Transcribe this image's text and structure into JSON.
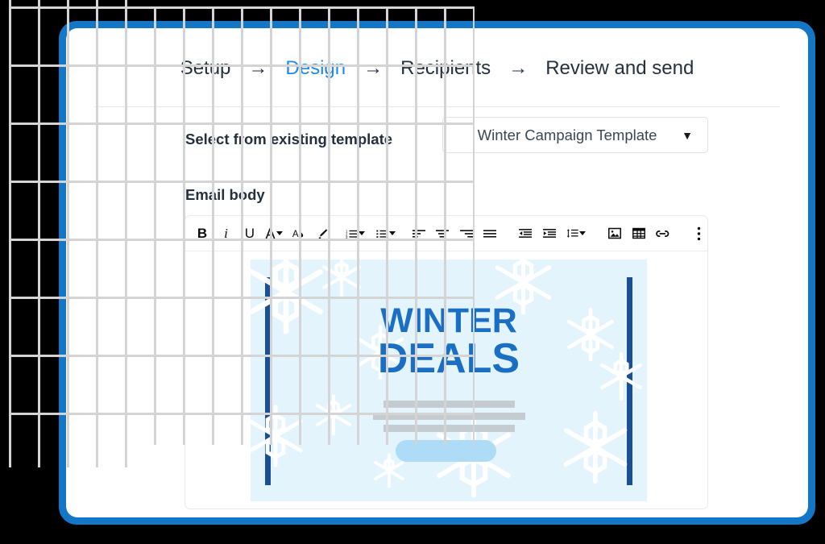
{
  "window": {
    "frame_color": "#1476c6",
    "card_background": "#ffffff"
  },
  "stepper": {
    "steps": [
      {
        "label": "Setup",
        "active": false
      },
      {
        "label": "Design",
        "active": true
      },
      {
        "label": "Recipients",
        "active": false
      },
      {
        "label": "Review and send",
        "active": false
      }
    ],
    "arrow": "→",
    "active_color": "#2089e4",
    "inactive_color": "#25303f"
  },
  "template": {
    "label": "Select from existing template",
    "selected_value": "Winter Campaign Template",
    "caret": "▼"
  },
  "email_body": {
    "label": "Email body"
  },
  "toolbar": {
    "items": [
      {
        "name": "bold",
        "glyph": "B"
      },
      {
        "name": "italic",
        "glyph": "i"
      },
      {
        "name": "underline",
        "glyph": "U"
      },
      {
        "name": "font-size",
        "glyph": "A"
      },
      {
        "name": "text-color",
        "glyph": "A"
      },
      {
        "name": "highlight",
        "glyph": "pen"
      },
      {
        "name": "numbered-list",
        "glyph": "list"
      },
      {
        "name": "bulleted-list",
        "glyph": "list"
      },
      {
        "name": "align-left",
        "glyph": "align"
      },
      {
        "name": "align-center",
        "glyph": "align"
      },
      {
        "name": "align-right",
        "glyph": "align"
      },
      {
        "name": "align-justify",
        "glyph": "align"
      },
      {
        "name": "outdent",
        "glyph": "indent"
      },
      {
        "name": "indent",
        "glyph": "indent"
      },
      {
        "name": "line-spacing",
        "glyph": "spacing"
      },
      {
        "name": "insert-image",
        "glyph": "image"
      },
      {
        "name": "insert-table",
        "glyph": "table"
      },
      {
        "name": "insert-link",
        "glyph": "link"
      },
      {
        "name": "more-options",
        "glyph": "kebab"
      }
    ]
  },
  "banner": {
    "title_line_1": "WINTER",
    "title_line_2": "DEALS",
    "background_color": "#e3f4fc",
    "title_color": "#1a6fc4",
    "bar_color": "#1a4f96",
    "placeholder_line_color": "#c5ccd1",
    "button_color": "#aedcf7",
    "snowflake_color": "#ffffff"
  }
}
